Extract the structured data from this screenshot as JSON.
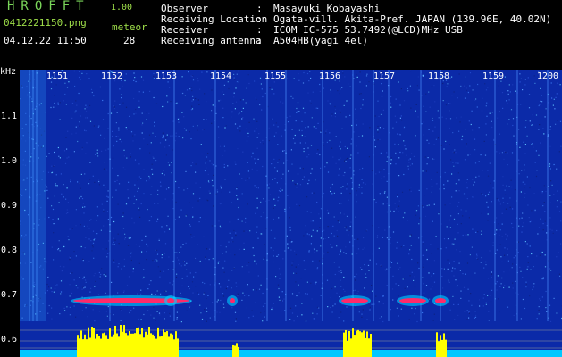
{
  "app": {
    "name": "HROFFT",
    "version": "1.00"
  },
  "file": {
    "name": "0412221150.png",
    "datetime": "04.12.22 11:50"
  },
  "meteor": {
    "label": "meteor",
    "count": "28"
  },
  "info": [
    {
      "label": "Observer",
      "value": "Masayuki Kobayashi"
    },
    {
      "label": "Receiving Location",
      "value": "Ogata-vill. Akita-Pref. JAPAN (139.96E, 40.02N)"
    },
    {
      "label": "Receiver",
      "value": "ICOM IC-575 53.7492(@LCD)MHz USB"
    },
    {
      "label": "Receiving antenna",
      "value": "A504HB(yagi 4el)"
    }
  ],
  "info_separator": ":",
  "spectrogram": {
    "y_unit": "kHz",
    "y_ticks": [
      "1.1",
      "1.0",
      "0.9",
      "0.8",
      "0.7",
      "0.6"
    ],
    "x_ticks": [
      "1151",
      "1152",
      "1153",
      "1154",
      "1155",
      "1156",
      "1157",
      "1158",
      "1159",
      "1200"
    ],
    "colors": {
      "background": "#0b2aa8",
      "signal": "#ff2a6a",
      "level": "#ffff00",
      "baseline": "#00c8ff"
    }
  }
}
